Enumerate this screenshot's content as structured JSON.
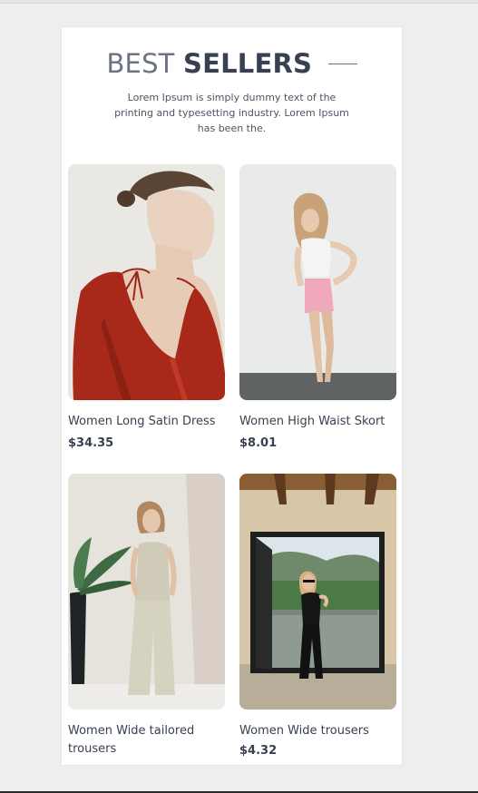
{
  "section": {
    "title_light": "BEST",
    "title_bold": "SELLERS",
    "description": "Lorem Ipsum is simply dummy text of the printing and typesetting industry. Lorem Ipsum has been the."
  },
  "products": [
    {
      "name": "Women Long Satin Dress",
      "price": "$34.35"
    },
    {
      "name": "Women High Waist Skort",
      "price": "$8.01"
    },
    {
      "name": "Women Wide tailored trousers",
      "price": ""
    },
    {
      "name": "Women Wide trousers",
      "price": "$4.32"
    }
  ]
}
